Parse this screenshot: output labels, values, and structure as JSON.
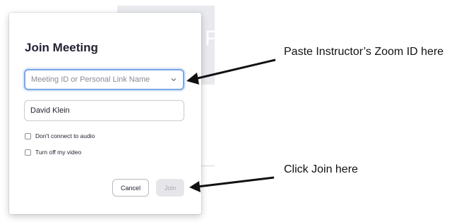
{
  "dialog": {
    "title": "Join Meeting",
    "meeting_id_placeholder": "Meeting ID or Personal Link Name",
    "name_value": "David Klein",
    "options": [
      {
        "label": "Don't connect to audio",
        "checked": false
      },
      {
        "label": "Turn off my video",
        "checked": false
      }
    ],
    "cancel_label": "Cancel",
    "join_label": "Join"
  },
  "annotations": {
    "zoom_id_note": "Paste Instructor’s Zoom ID here",
    "join_note": "Click Join here"
  },
  "colors": {
    "focus_border": "#7aa7e8",
    "join_disabled_bg": "#e6e6ea",
    "text_dark": "#232333",
    "arrow": "#111111"
  },
  "icons": {
    "dropdown": "chevron-down-icon",
    "pointer": "arrow-icon"
  }
}
